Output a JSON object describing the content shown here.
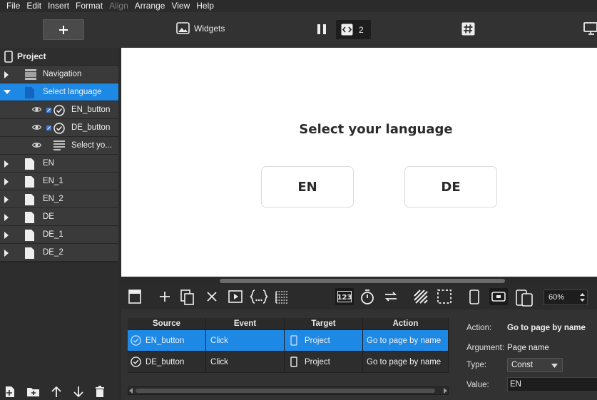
{
  "menu": [
    "File",
    "Edit",
    "Insert",
    "Format",
    "Align",
    "Arrange",
    "View",
    "Help"
  ],
  "menu_disabled": "Align",
  "toolbar": {
    "widgets_label": "Widgets",
    "code_count": "2"
  },
  "tree": {
    "root_label": "Project",
    "items": [
      {
        "label": "Navigation",
        "icon": "navigation-bar-icon",
        "expanded": false
      },
      {
        "label": "Select language",
        "icon": "page-icon",
        "expanded": true,
        "selected": true
      },
      {
        "label": "EN_button",
        "icon": "button-check-icon",
        "child": true
      },
      {
        "label": "DE_button",
        "icon": "button-check-icon",
        "child": true
      },
      {
        "label": "Select yo...",
        "icon": "text-icon",
        "child": true
      },
      {
        "label": "EN",
        "icon": "page-icon"
      },
      {
        "label": "EN_1",
        "icon": "page-icon"
      },
      {
        "label": "EN_2",
        "icon": "page-icon"
      },
      {
        "label": "DE",
        "icon": "page-icon"
      },
      {
        "label": "DE_1",
        "icon": "page-icon"
      },
      {
        "label": "DE_2",
        "icon": "page-icon"
      }
    ]
  },
  "canvas": {
    "title": "Select your language",
    "buttons": [
      "EN",
      "DE"
    ]
  },
  "zoom": "60%",
  "events": {
    "headers": [
      "Source",
      "Event",
      "Target",
      "Action"
    ],
    "rows": [
      {
        "source": "EN_button",
        "event": "Click",
        "target": "Project",
        "action": "Go to page by name",
        "selected": true
      },
      {
        "source": "DE_button",
        "event": "Click",
        "target": "Project",
        "action": "Go to page by name",
        "selected": false
      }
    ]
  },
  "properties": {
    "action_label": "Action:",
    "action_value": "Go to page by name",
    "argument_label": "Argument:",
    "argument_value": "Page name",
    "type_label": "Type:",
    "type_value": "Const",
    "value_label": "Value:",
    "value_value": "EN"
  },
  "colors": {
    "accent": "#1e88e5",
    "background": "#2b2b2b",
    "panel": "#333333"
  }
}
